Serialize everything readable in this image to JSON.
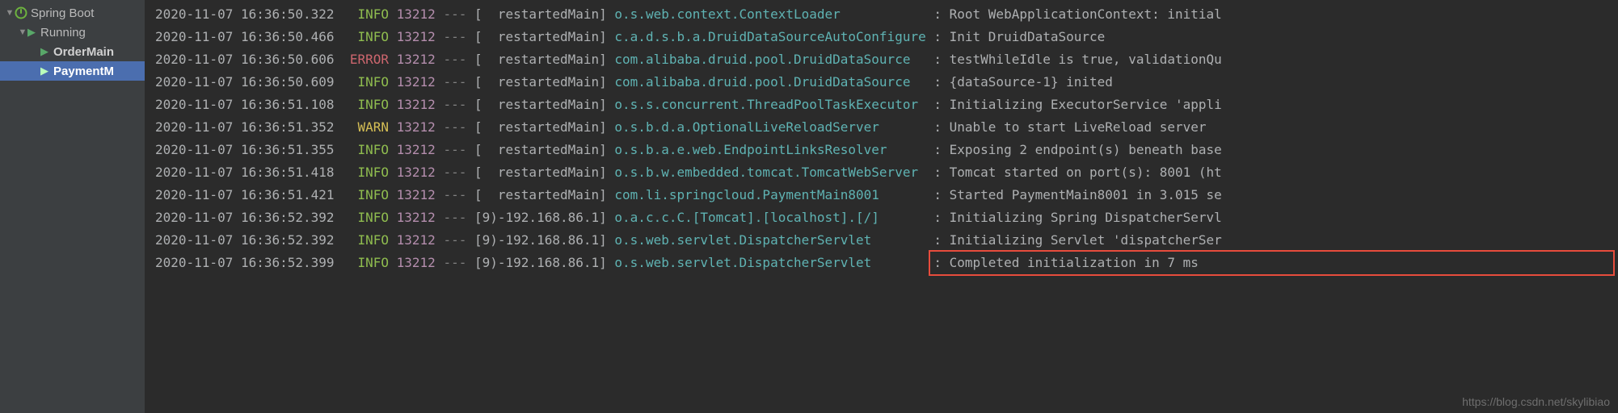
{
  "sidebar": {
    "root": {
      "label": "Spring Boot"
    },
    "running": {
      "label": "Running"
    },
    "items": [
      {
        "label": "OrderMain"
      },
      {
        "label": "PaymentM"
      }
    ]
  },
  "log": {
    "lines": [
      {
        "ts": "2020-11-07 16:36:50.322",
        "level": "INFO",
        "pid": "13212",
        "thread": "  restartedMain",
        "logger": "o.s.web.context.ContextLoader           ",
        "msg": " Root WebApplicationContext: initial"
      },
      {
        "ts": "2020-11-07 16:36:50.466",
        "level": "INFO",
        "pid": "13212",
        "thread": "  restartedMain",
        "logger": "c.a.d.s.b.a.DruidDataSourceAutoConfigure",
        "msg": " Init DruidDataSource"
      },
      {
        "ts": "2020-11-07 16:36:50.606",
        "level": "ERROR",
        "pid": "13212",
        "thread": "  restartedMain",
        "logger": "com.alibaba.druid.pool.DruidDataSource  ",
        "msg": " testWhileIdle is true, validationQu"
      },
      {
        "ts": "2020-11-07 16:36:50.609",
        "level": "INFO",
        "pid": "13212",
        "thread": "  restartedMain",
        "logger": "com.alibaba.druid.pool.DruidDataSource  ",
        "msg": " {dataSource-1} inited"
      },
      {
        "ts": "2020-11-07 16:36:51.108",
        "level": "INFO",
        "pid": "13212",
        "thread": "  restartedMain",
        "logger": "o.s.s.concurrent.ThreadPoolTaskExecutor ",
        "msg": " Initializing ExecutorService 'appli"
      },
      {
        "ts": "2020-11-07 16:36:51.352",
        "level": "WARN",
        "pid": "13212",
        "thread": "  restartedMain",
        "logger": "o.s.b.d.a.OptionalLiveReloadServer      ",
        "msg": " Unable to start LiveReload server "
      },
      {
        "ts": "2020-11-07 16:36:51.355",
        "level": "INFO",
        "pid": "13212",
        "thread": "  restartedMain",
        "logger": "o.s.b.a.e.web.EndpointLinksResolver     ",
        "msg": " Exposing 2 endpoint(s) beneath base"
      },
      {
        "ts": "2020-11-07 16:36:51.418",
        "level": "INFO",
        "pid": "13212",
        "thread": "  restartedMain",
        "logger": "o.s.b.w.embedded.tomcat.TomcatWebServer ",
        "msg": " Tomcat started on port(s): 8001 (ht"
      },
      {
        "ts": "2020-11-07 16:36:51.421",
        "level": "INFO",
        "pid": "13212",
        "thread": "  restartedMain",
        "logger": "com.li.springcloud.PaymentMain8001      ",
        "msg": " Started PaymentMain8001 in 3.015 se"
      },
      {
        "ts": "2020-11-07 16:36:52.392",
        "level": "INFO",
        "pid": "13212",
        "thread": "9)-192.168.86.1",
        "logger": "o.a.c.c.C.[Tomcat].[localhost].[/]      ",
        "msg": " Initializing Spring DispatcherServl"
      },
      {
        "ts": "2020-11-07 16:36:52.392",
        "level": "INFO",
        "pid": "13212",
        "thread": "9)-192.168.86.1",
        "logger": "o.s.web.servlet.DispatcherServlet       ",
        "msg": " Initializing Servlet 'dispatcherSer"
      },
      {
        "ts": "2020-11-07 16:36:52.399",
        "level": "INFO",
        "pid": "13212",
        "thread": "9)-192.168.86.1",
        "logger": "o.s.web.servlet.DispatcherServlet       ",
        "msg": " Completed initialization in 7 ms"
      }
    ]
  },
  "watermark": "https://blog.csdn.net/skylibiao"
}
